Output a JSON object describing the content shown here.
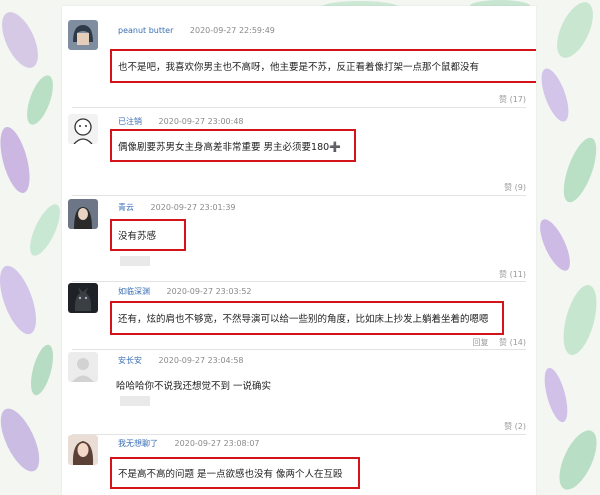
{
  "comments": [
    {
      "user": "peanut butter",
      "time": "2020-09-27 22:59:49",
      "text": "也不是吧，我喜欢你男主也不高呀，他主要是不苏，反正看着像打架一点那个鼠都没有",
      "like": "赞 (17)",
      "reply": ""
    },
    {
      "user": "已注销",
      "time": "2020-09-27 23:00:48",
      "text": "偶像剧要苏男女主身高差非常重要 男主必须要180➕",
      "like": "赞 (9)",
      "reply": ""
    },
    {
      "user": "青云",
      "time": "2020-09-27 23:01:39",
      "text": "没有苏感",
      "like": "赞 (11)",
      "reply": ""
    },
    {
      "user": "如临深渊",
      "time": "2020-09-27 23:03:52",
      "text": "还有，炫的肩也不够宽，不然导演可以给一些别的角度，比如床上抄发上躺着坐着的嗯嗯",
      "like": "赞 (14)",
      "reply": "回复"
    },
    {
      "user": "安长安",
      "time": "2020-09-27 23:04:58",
      "text": "哈哈哈你不说我还想觉不到 一说确实",
      "like": "赞 (2)",
      "reply": ""
    },
    {
      "user": "我无想聊了",
      "time": "2020-09-27 23:08:07",
      "text": "不是高不高的问题 是一点欲感也没有 像两个人在互殴",
      "like": "",
      "reply": ""
    }
  ],
  "colors": {
    "highlight": "#d4141b",
    "username": "#3b6fb5",
    "meta": "#8a8a8a"
  },
  "icons": [
    "avatar-bob-icon",
    "avatar-cartoon-icon",
    "avatar-girl-icon",
    "avatar-black-dog-icon",
    "avatar-blank-icon",
    "avatar-woman-icon"
  ]
}
